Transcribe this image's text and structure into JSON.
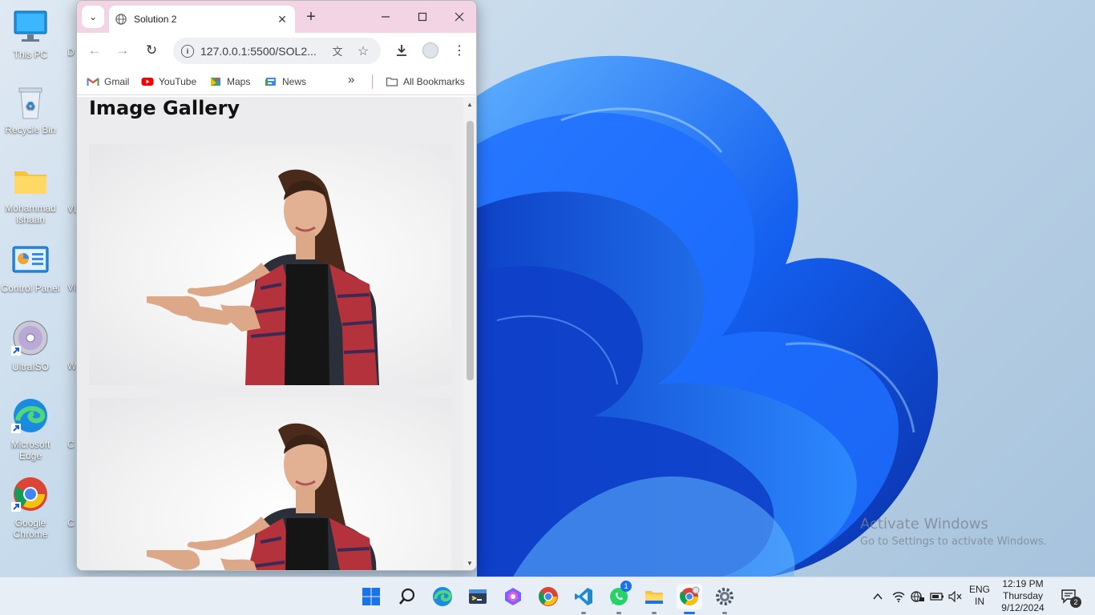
{
  "desktop": {
    "icons": [
      {
        "label": "This PC"
      },
      {
        "label": "Recycle Bin"
      },
      {
        "label": "Mohammad Ishaan"
      },
      {
        "label": "Control Panel"
      },
      {
        "label": "UltraISO"
      },
      {
        "label": "Microsoft Edge"
      },
      {
        "label": "Google Chrome"
      }
    ],
    "partial_icons": [
      "D",
      "VL",
      "Vis",
      "W",
      "C",
      "C"
    ],
    "activate_title": "Activate Windows",
    "activate_subtitle": "Go to Settings to activate Windows."
  },
  "browser": {
    "tab_title": "Solution 2",
    "url": "127.0.0.1:5500/SOL2...",
    "bookmarks": [
      {
        "label": "Gmail",
        "icon": "gmail-icon"
      },
      {
        "label": "YouTube",
        "icon": "youtube-icon"
      },
      {
        "label": "Maps",
        "icon": "maps-icon"
      },
      {
        "label": "News",
        "icon": "news-icon"
      }
    ],
    "all_bookmarks": "All Bookmarks"
  },
  "page": {
    "heading": "Image Gallery"
  },
  "taskbar": {
    "apps": [
      "start",
      "search",
      "edge",
      "terminal",
      "copilot",
      "chrome",
      "vscode",
      "whatsapp",
      "file-explorer",
      "chrome-profile",
      "settings"
    ],
    "whatsapp_badge": "1",
    "lang_line1": "ENG",
    "lang_line2": "IN",
    "time": "12:19 PM",
    "day": "Thursday",
    "date": "9/12/2024",
    "notification_count": "2"
  },
  "colors": {
    "tabstrip": "#f3d4e4",
    "accent": "#1a73e8",
    "page_background": "#ececee"
  }
}
